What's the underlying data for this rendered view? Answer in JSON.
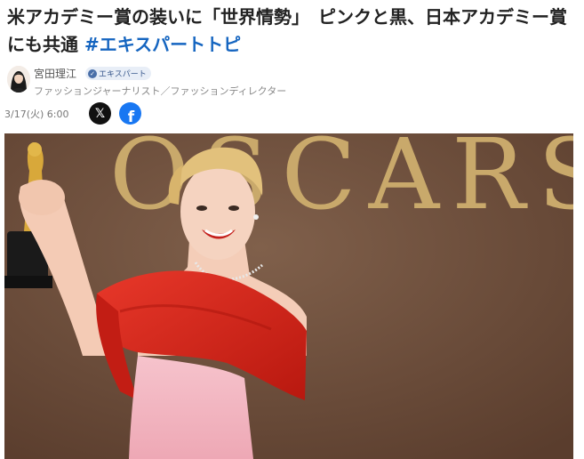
{
  "headline": {
    "text": "米アカデミー賞の装いに「世界情勢」　ピンクと黒、日本アカデミー賞にも共通 ",
    "hashtag": "#エキスパートトピ"
  },
  "author": {
    "name": "宮田理江",
    "badge": "エキスパート",
    "title": "ファッションジャーナリスト／ファッションディレクター"
  },
  "meta": {
    "date": "3/17(火) 6:00"
  },
  "share": {
    "x_label": "𝕏",
    "fb_label": "f"
  },
  "photo": {
    "backdrop_text": "OSCARS",
    "colors": {
      "backdrop": "#6f4f3d",
      "lettering": "#c9a96b",
      "dress_pink": "#f2b5c0",
      "wrap_red": "#d8241a"
    }
  }
}
